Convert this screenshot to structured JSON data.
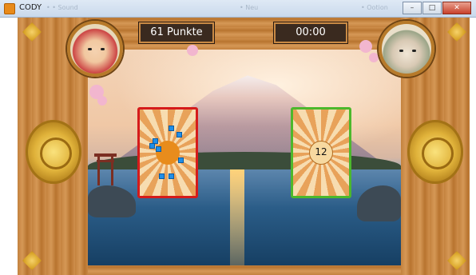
{
  "window": {
    "title": "CODY",
    "faded_left": "• • Sound",
    "faded_mid": "• Neu",
    "faded_right": "• Ootion",
    "minimize": "–",
    "maximize": "□",
    "close": "✕"
  },
  "hud": {
    "points": "61 Punkte",
    "timer": "00:00"
  },
  "cards": {
    "left_dots_count": 8,
    "right_number": "12"
  },
  "colors": {
    "left_card_border": "#d51b1b",
    "right_card_border": "#4cb82c",
    "dot": "#1f8ee8"
  },
  "icons": {
    "app": "cody-app-icon",
    "left_avatar": "samurai-boy-avatar",
    "right_avatar": "old-sage-avatar",
    "medallion": "gold-medallion-ornament"
  }
}
